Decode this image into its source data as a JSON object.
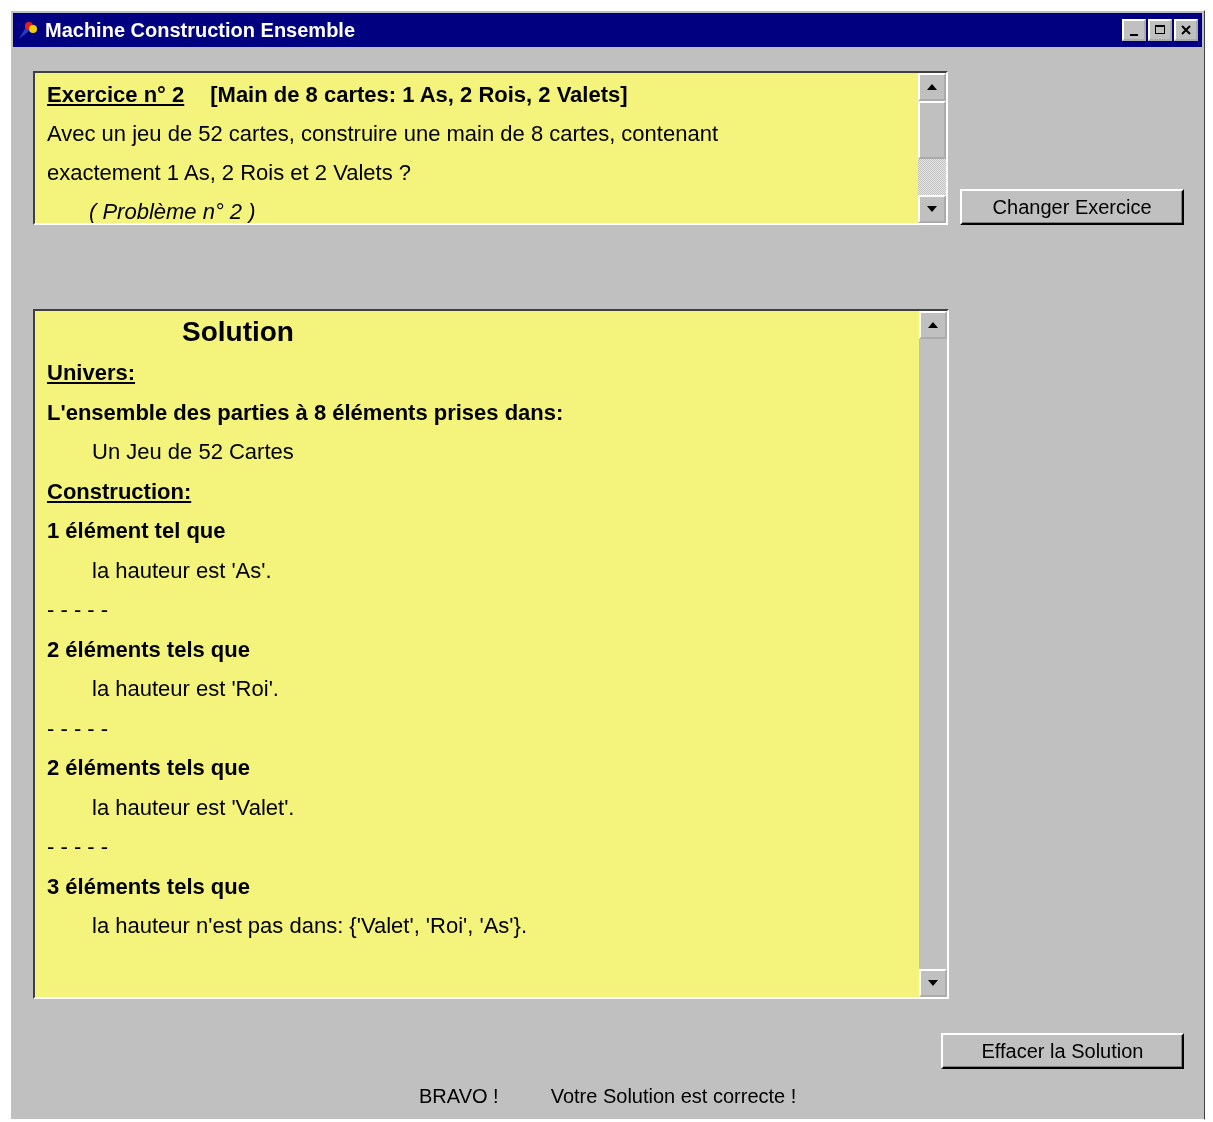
{
  "window": {
    "title": "Machine Construction Ensemble"
  },
  "exercise": {
    "heading": "Exercice n° 2",
    "subtitle": "[Main de 8 cartes: 1 As, 2 Rois, 2 Valets]",
    "lines": [
      "Avec un jeu de 52 cartes, construire une main de 8 cartes, contenant",
      "exactement 1 As, 2 Rois et 2 Valets ?"
    ],
    "note": "( Problème n° 2 )"
  },
  "change_button": "Changer Exercice",
  "solution": {
    "title": "Solution",
    "lines": [
      {
        "kind": "label",
        "text": "Univers:"
      },
      {
        "kind": "bold",
        "text": "L'ensemble des parties à 8 éléments prises dans:"
      },
      {
        "kind": "indent",
        "text": "Un Jeu de 52 Cartes"
      },
      {
        "kind": "label",
        "text": "Construction:"
      },
      {
        "kind": "bold",
        "text": "1 élément  tel que"
      },
      {
        "kind": "indent",
        "text": "la hauteur est 'As'."
      },
      {
        "kind": "separator",
        "text": "- - - - -"
      },
      {
        "kind": "bold",
        "text": "2 éléments  tels que"
      },
      {
        "kind": "indent",
        "text": "la hauteur est 'Roi'."
      },
      {
        "kind": "separator",
        "text": "- - - - -"
      },
      {
        "kind": "bold",
        "text": "2 éléments  tels que"
      },
      {
        "kind": "indent",
        "text": "la hauteur est 'Valet'."
      },
      {
        "kind": "separator",
        "text": "- - - - -"
      },
      {
        "kind": "bold",
        "text": "3 éléments  tels que"
      },
      {
        "kind": "indent",
        "text": "la hauteur n'est pas dans: {'Valet', 'Roi', 'As'}."
      }
    ]
  },
  "clear_button": "Effacer la Solution",
  "status": {
    "result": "BRAVO !",
    "message": "Votre Solution est correcte !"
  }
}
